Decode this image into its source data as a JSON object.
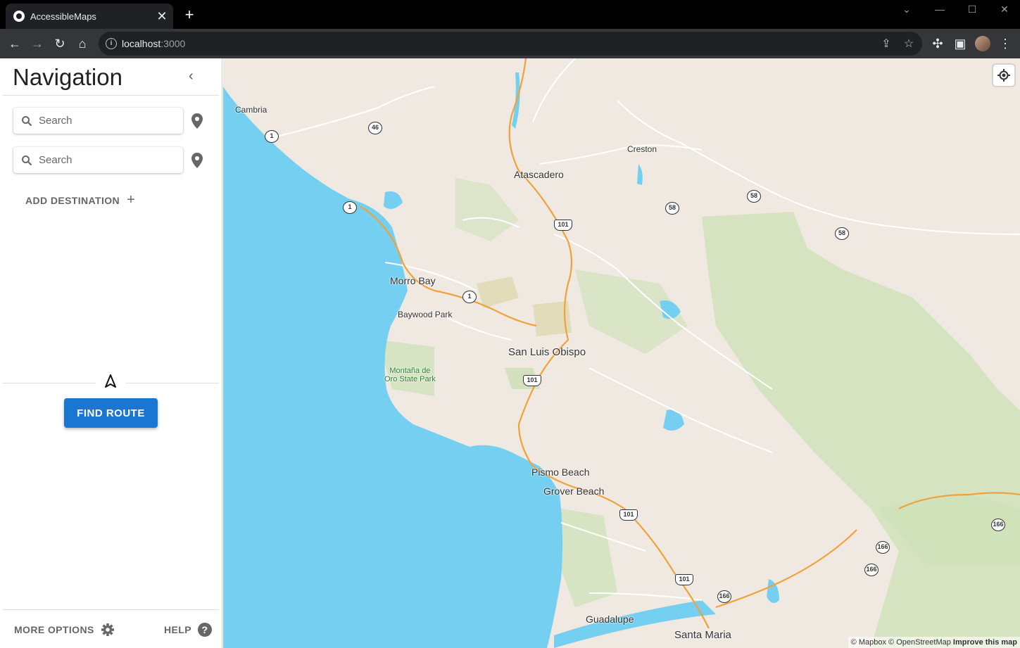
{
  "browser": {
    "tab_title": "AccessibleMaps",
    "url_host": "localhost",
    "url_port": ":3000",
    "new_tab": "+",
    "tab_close": "✕"
  },
  "sidebar": {
    "title": "Navigation",
    "collapse_glyph": "‹",
    "search_fields": [
      {
        "placeholder": "Search",
        "value": ""
      },
      {
        "placeholder": "Search",
        "value": ""
      }
    ],
    "add_destination_label": "ADD DESTINATION",
    "add_destination_glyph": "+",
    "find_route_label": "FIND ROUTE",
    "more_options_label": "MORE OPTIONS",
    "help_label": "HELP",
    "help_glyph": "?"
  },
  "map": {
    "places": {
      "cambria": "Cambria",
      "creston": "Creston",
      "atascadero": "Atascadero",
      "morro_bay": "Morro Bay",
      "baywood_park": "Baywood Park",
      "san_luis_obispo": "San Luis Obispo",
      "montana_de_oro_line1": "Montaña de",
      "montana_de_oro_line2": "Oro State Park",
      "pismo_beach": "Pismo Beach",
      "grover_beach": "Grover Beach",
      "guadalupe": "Guadalupe",
      "santa_maria": "Santa Maria"
    },
    "route_shields": {
      "r1a": "1",
      "r1b": "1",
      "r1c": "1",
      "r46": "46",
      "r58a": "58",
      "r58b": "58",
      "r58c": "58",
      "r101a": "101",
      "r101b": "101",
      "r101c": "101",
      "r101d": "101",
      "r166a": "166",
      "r166b": "166",
      "r166c": "166",
      "r166d": "166"
    },
    "attribution": {
      "mapbox": "© Mapbox",
      "osm": "© OpenStreetMap",
      "improve": "Improve this map"
    },
    "colors": {
      "water": "#75cff0",
      "land": "#efe9e1",
      "park": "#c8dfb0",
      "highway": "#f0a23a"
    }
  }
}
